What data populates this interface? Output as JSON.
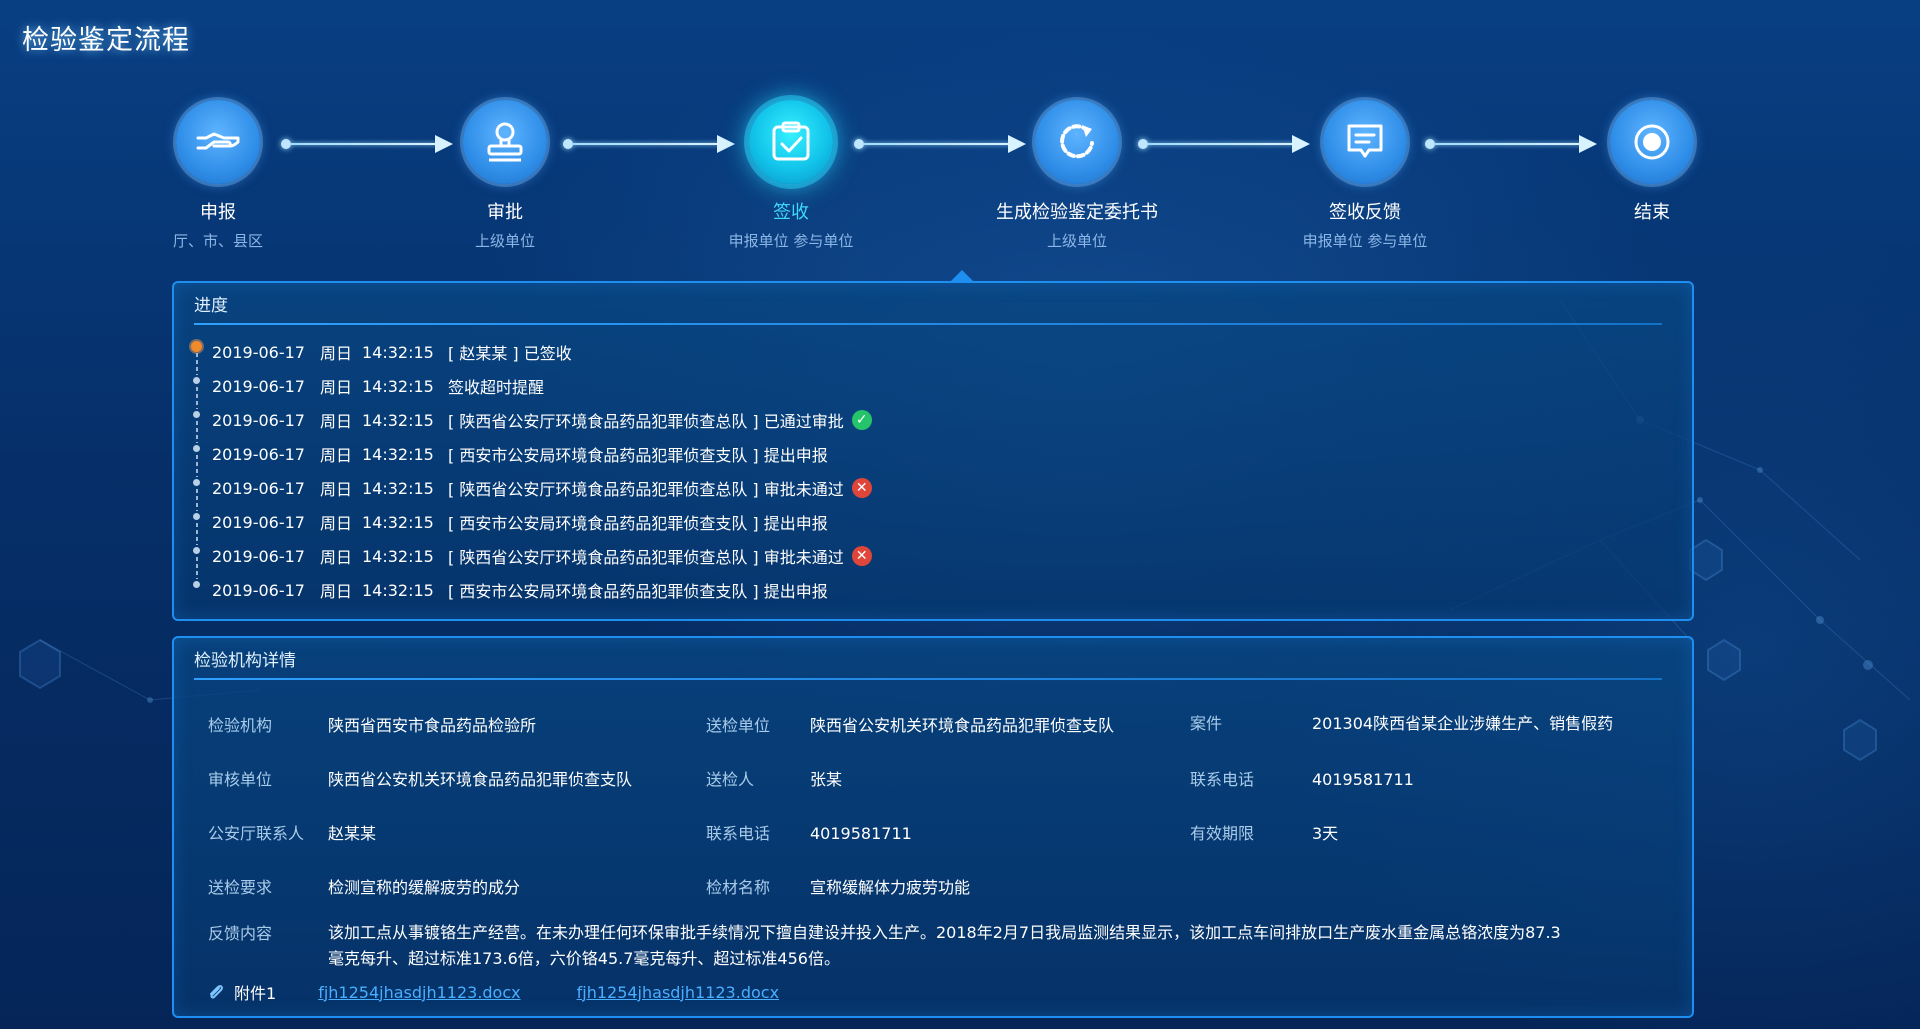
{
  "page": {
    "title": "检验鉴定流程"
  },
  "steps": [
    {
      "name": "申报",
      "sub": "厅、市、县区",
      "icon": "hand-icon"
    },
    {
      "name": "审批",
      "sub": "上级单位",
      "icon": "stamp-icon"
    },
    {
      "name": "签收",
      "sub": "申报单位 参与单位",
      "icon": "clipboard-check-icon",
      "active": true
    },
    {
      "name": "生成检验鉴定委托书",
      "sub": "上级单位",
      "icon": "refresh-icon"
    },
    {
      "name": "签收反馈",
      "sub": "申报单位 参与单位",
      "icon": "message-icon"
    },
    {
      "name": "结束",
      "sub": "",
      "icon": "target-icon"
    }
  ],
  "progress": {
    "title": "进度",
    "items": [
      {
        "date": "2019-06-17",
        "weekday": "周日",
        "time": "14:32:15",
        "message": "[ 赵某某 ] 已签收",
        "status": ""
      },
      {
        "date": "2019-06-17",
        "weekday": "周日",
        "time": "14:32:15",
        "message": "签收超时提醒",
        "status": ""
      },
      {
        "date": "2019-06-17",
        "weekday": "周日",
        "time": "14:32:15",
        "message": "[ 陕西省公安厅环境食品药品犯罪侦查总队 ] 已通过审批",
        "status": "approved"
      },
      {
        "date": "2019-06-17",
        "weekday": "周日",
        "time": "14:32:15",
        "message": "[ 西安市公安局环境食品药品犯罪侦查支队 ] 提出申报",
        "status": ""
      },
      {
        "date": "2019-06-17",
        "weekday": "周日",
        "time": "14:32:15",
        "message": "[ 陕西省公安厅环境食品药品犯罪侦查总队 ] 审批未通过",
        "status": "rejected"
      },
      {
        "date": "2019-06-17",
        "weekday": "周日",
        "time": "14:32:15",
        "message": "[ 西安市公安局环境食品药品犯罪侦查支队 ] 提出申报",
        "status": ""
      },
      {
        "date": "2019-06-17",
        "weekday": "周日",
        "time": "14:32:15",
        "message": "[ 陕西省公安厅环境食品药品犯罪侦查总队 ] 审批未通过",
        "status": "rejected"
      },
      {
        "date": "2019-06-17",
        "weekday": "周日",
        "time": "14:32:15",
        "message": "[ 西安市公安局环境食品药品犯罪侦查支队 ] 提出申报",
        "status": ""
      }
    ]
  },
  "details": {
    "title": "检验机构详情",
    "fields": [
      {
        "label": "检验机构",
        "value": "陕西省西安市食品药品检验所"
      },
      {
        "label": "送检单位",
        "value": "陕西省公安机关环境食品药品犯罪侦查支队"
      },
      {
        "label": "案件",
        "value": "201304陕西省某企业涉嫌生产、销售假药"
      },
      {
        "label": "审核单位",
        "value": "陕西省公安机关环境食品药品犯罪侦查支队"
      },
      {
        "label": "送检人",
        "value": "张某"
      },
      {
        "label": "联系电话",
        "value": "4019581711"
      },
      {
        "label": "公安厅联系人",
        "value": "赵某某"
      },
      {
        "label": "联系电话",
        "value": "4019581711"
      },
      {
        "label": "有效期限",
        "value": "3天"
      },
      {
        "label": "送检要求",
        "value": "检测宣称的缓解疲劳的成分"
      },
      {
        "label": "检材名称",
        "value": "宣称缓解体力疲劳功能"
      }
    ],
    "feedback": {
      "label": "反馈内容",
      "value": "该加工点从事镀铬生产经营。在未办理任何环保审批手续情况下擅自建设并投入生产。2018年2月7日我局监测结果显示，该加工点车间排放口生产废水重金属总铬浓度为87.3毫克每升、超过标准173.6倍，六价铬45.7毫克每升、超过标准456倍。"
    },
    "attachment": {
      "label": "附件1",
      "files": [
        "fjh1254jhasdjh1123.docx",
        "fjh1254jhasdjh1123.docx"
      ]
    }
  },
  "colors": {
    "accent": "#1e8ef0",
    "active": "#3fd8ff",
    "approved": "#25c46a",
    "rejected": "#e0453a",
    "current": "#f08a2a"
  }
}
